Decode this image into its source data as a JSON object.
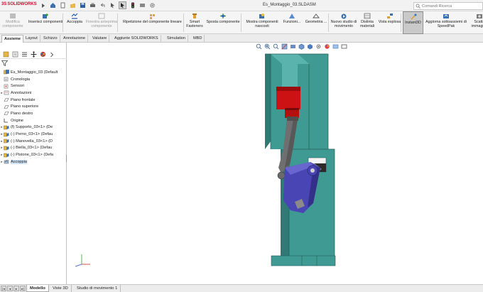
{
  "app": {
    "logo_text": "SOLIDWORKS",
    "logo_prefix": "3S",
    "document_title": "Es_Montaggio_03.SLDASM"
  },
  "search": {
    "placeholder": "Comandi Ricerca"
  },
  "ribbon": [
    {
      "label": "Modifica componente",
      "icon": "edit-component-icon",
      "disabled": true
    },
    {
      "label": "Inserisci componenti",
      "icon": "insert-component-icon",
      "disabled": false
    },
    {
      "label": "Accoppia",
      "icon": "mate-icon",
      "disabled": false
    },
    {
      "label": "Finestra anteprima componente",
      "icon": "preview-window-icon",
      "disabled": true
    },
    {
      "label": "Ripetizione del componente lineare",
      "icon": "linear-pattern-icon",
      "disabled": false
    },
    {
      "label": "Smart Fasteners",
      "icon": "smart-fasteners-icon",
      "disabled": false
    },
    {
      "label": "Sposta componente",
      "icon": "move-component-icon",
      "disabled": false
    },
    {
      "label": "Mostra componenti nascosti",
      "icon": "show-hidden-icon",
      "disabled": false
    },
    {
      "label": "Funzioni...",
      "icon": "features-icon",
      "disabled": false
    },
    {
      "label": "Geometria ...",
      "icon": "reference-geometry-icon",
      "disabled": false
    },
    {
      "label": "Nuovo studio di movimento",
      "icon": "motion-study-icon",
      "disabled": false
    },
    {
      "label": "Distinta materiali",
      "icon": "bom-icon",
      "disabled": false
    },
    {
      "label": "Vista esplosa",
      "icon": "exploded-view-icon",
      "disabled": false
    },
    {
      "label": "Instant3D",
      "icon": "instant3d-icon",
      "disabled": false,
      "active": true
    },
    {
      "label": "Aggiorna sottoassiemi di SpeedPak",
      "icon": "speedpak-icon",
      "disabled": false
    },
    {
      "label": "Scatta immagine",
      "icon": "snapshot-icon",
      "disabled": false
    }
  ],
  "tabs": [
    "Assieme",
    "Layout",
    "Schizzo",
    "Annotazione",
    "Valutare",
    "Aggiunte SOLIDWORKS",
    "Simulation",
    "MBD"
  ],
  "active_tab": "Assieme",
  "tree": {
    "root": "Es_Montaggio_03  (Default",
    "items": [
      {
        "label": "Cronologia",
        "icon": "history-icon",
        "expand": ""
      },
      {
        "label": "Sensori",
        "icon": "sensor-icon",
        "expand": ""
      },
      {
        "label": "Annotazioni",
        "icon": "annotation-icon",
        "expand": "▸"
      },
      {
        "label": "Piano frontale",
        "icon": "plane-icon",
        "expand": ""
      },
      {
        "label": "Piano superiore",
        "icon": "plane-icon",
        "expand": ""
      },
      {
        "label": "Piano destro",
        "icon": "plane-icon",
        "expand": ""
      },
      {
        "label": "Origine",
        "icon": "origin-icon",
        "expand": ""
      },
      {
        "label": "(f) Supporto_03<1> (De",
        "icon": "part-icon",
        "expand": "▸"
      },
      {
        "label": "(-) Perno_03<1> (Defau",
        "icon": "part-icon",
        "expand": "▸"
      },
      {
        "label": "(-) Manovella_03<1> (D",
        "icon": "part-icon",
        "expand": "▸"
      },
      {
        "label": "(-) Biella_03<1> (Defau",
        "icon": "part-icon",
        "expand": "▸"
      },
      {
        "label": "(-) Pistone_03<1> (Defa",
        "icon": "part-icon",
        "expand": "▸"
      },
      {
        "label": "Accoppia",
        "icon": "mates-folder-icon",
        "expand": "▸",
        "selected": true
      }
    ]
  },
  "bottom_tabs": [
    "Modello",
    "Viste 3D",
    "Studio di movimento 1"
  ],
  "active_bottom_tab": "Modello",
  "colors": {
    "support": "#3e9a93",
    "support_dark": "#2f7a75",
    "support_light": "#5bb3ad",
    "piston": "#cc1212",
    "crank": "#4a45b5",
    "rod": "#6f6f6f",
    "accent": "#c8102e"
  }
}
